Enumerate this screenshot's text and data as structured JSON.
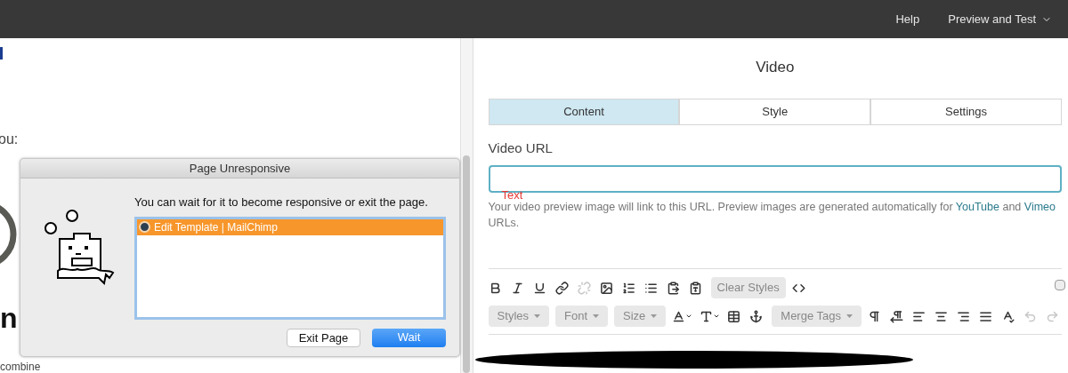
{
  "top_bar": {
    "links": [
      {
        "label": "Help",
        "dropdown": false
      },
      {
        "label": "Preview and Test",
        "dropdown": true
      }
    ]
  },
  "page": {
    "label_text": "ou:",
    "heading_text": "n",
    "body_text": "combine"
  },
  "panel": {
    "title": "Video",
    "tabs": [
      {
        "label": "Content",
        "selected": true
      },
      {
        "label": "Style",
        "selected": false
      },
      {
        "label": "Settings",
        "selected": false
      }
    ],
    "field": {
      "label": "Video URL",
      "overlay_text": "Text"
    },
    "help": [
      {
        "text": "Your video preview image will link to this URL. Preview images are generated automatically for ",
        "link": false
      },
      {
        "text": "YouTube",
        "link": true
      },
      {
        "text": " and ",
        "link": false
      },
      {
        "text": "Vimeo",
        "link": true
      },
      {
        "text": " URLs.",
        "link": false
      }
    ],
    "toolbar": [
      [
        {
          "kind": "bold",
          "disabled": false
        },
        {
          "kind": "italic",
          "disabled": false
        },
        {
          "kind": "underline",
          "disabled": false
        },
        {
          "kind": "link",
          "disabled": false
        },
        {
          "kind": "unlink",
          "disabled": true
        },
        {
          "kind": "image",
          "disabled": false
        },
        {
          "kind": "ordered-list",
          "disabled": false
        },
        {
          "kind": "bullet-list",
          "disabled": false
        },
        {
          "kind": "paste",
          "disabled": false
        },
        {
          "kind": "paste-word",
          "disabled": false
        },
        {
          "kind": "button",
          "label": "Clear Styles"
        },
        {
          "kind": "code",
          "disabled": false
        }
      ],
      [
        {
          "kind": "dropdown",
          "label": "Styles"
        },
        {
          "kind": "dropdown",
          "label": "Font"
        },
        {
          "kind": "dropdown",
          "label": "Size"
        },
        {
          "kind": "text-color",
          "disabled": false
        },
        {
          "kind": "background-color",
          "disabled": false
        },
        {
          "kind": "block",
          "disabled": false
        },
        {
          "kind": "anchor",
          "disabled": false
        },
        {
          "kind": "dropdown",
          "label": "Merge Tags"
        },
        {
          "kind": "ltr",
          "disabled": false
        },
        {
          "kind": "rtl",
          "disabled": false
        },
        {
          "kind": "align-left",
          "disabled": false
        },
        {
          "kind": "align-center",
          "disabled": false
        },
        {
          "kind": "align-right",
          "disabled": false
        },
        {
          "kind": "align-justify",
          "disabled": false
        },
        {
          "kind": "spellcheck",
          "disabled": false
        },
        {
          "kind": "undo",
          "disabled": true
        },
        {
          "kind": "redo",
          "disabled": true
        }
      ]
    ]
  },
  "dialog": {
    "title": "Page Unresponsive",
    "message": "You can wait for it to become responsive or exit the page.",
    "pages": [
      {
        "label": "Edit Template | MailChimp",
        "selected": true
      }
    ],
    "buttons": [
      {
        "label": "Exit Page",
        "primary": false
      },
      {
        "label": "Wait",
        "primary": true
      }
    ]
  }
}
